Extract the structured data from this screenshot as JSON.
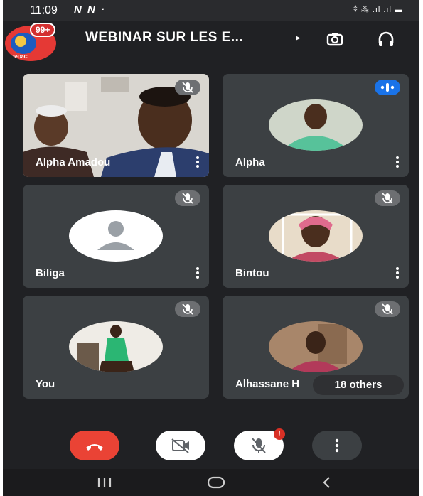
{
  "status_bar": {
    "time": "11:09",
    "notifications": "N  N ·",
    "right_icons": "⁑ ⁂ .ıl .ıl ▬"
  },
  "header": {
    "notification_badge": "99+",
    "logo_text": "MeDaC",
    "meeting_title": "WEBINAR SUR LES E...",
    "title_arrow": "▸",
    "camera_switch_icon": "camera-switch-icon",
    "audio_icon": "headphones-icon"
  },
  "participants": [
    {
      "name": "Alpha Amadou",
      "muted": true
    },
    {
      "name": "Alpha",
      "muted": false,
      "speaking": true
    },
    {
      "name": "Biliga",
      "muted": true
    },
    {
      "name": "Bintou",
      "muted": true
    },
    {
      "name": "You",
      "muted": true
    },
    {
      "name": "Alhassane H",
      "muted": true
    }
  ],
  "others_label": "18 others",
  "controls": {
    "end_call": "end-call-icon",
    "camera": "camera-off-icon",
    "mic": "mic-off-icon",
    "mic_alert": "!",
    "more": "more-icon"
  },
  "colors": {
    "end_call": "#ea4335",
    "speaking": "#1a73e8",
    "tile_bg": "#3c4043",
    "app_bg": "#202124"
  }
}
